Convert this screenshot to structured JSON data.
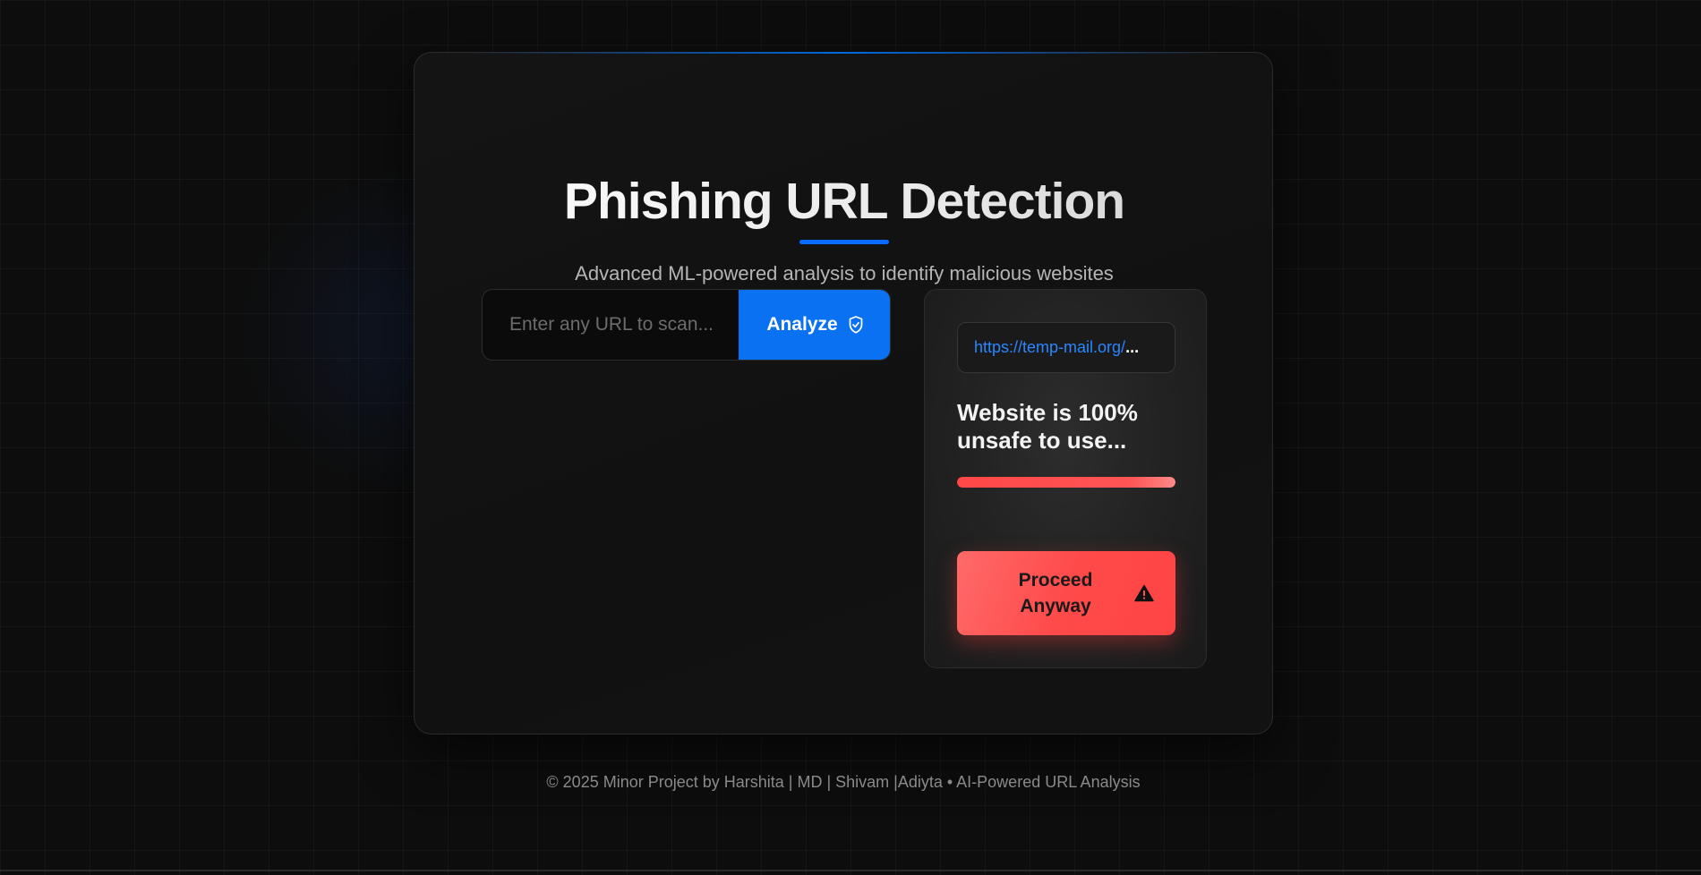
{
  "header": {
    "title": "Phishing URL Detection",
    "subtitle": "Advanced ML-powered analysis to identify malicious websites"
  },
  "search": {
    "placeholder": "Enter any URL to scan...",
    "value": "",
    "analyze_label": "Analyze",
    "analyze_icon": "shield-icon"
  },
  "result": {
    "url": "https://temp-mail.org/",
    "url_overflow": "...",
    "verdict": "Website is 100% unsafe to use...",
    "risk_percent": 100,
    "proceed_label": "Proceed Anyway",
    "proceed_icon": "warning-triangle-icon"
  },
  "footer": {
    "text": "© 2025 Minor Project by Harshita | MD | Shivam |Adiyta • AI-Powered URL Analysis"
  },
  "colors": {
    "accent": "#0a72f2",
    "danger": "#ff4747",
    "background": "#0d0d0d"
  }
}
